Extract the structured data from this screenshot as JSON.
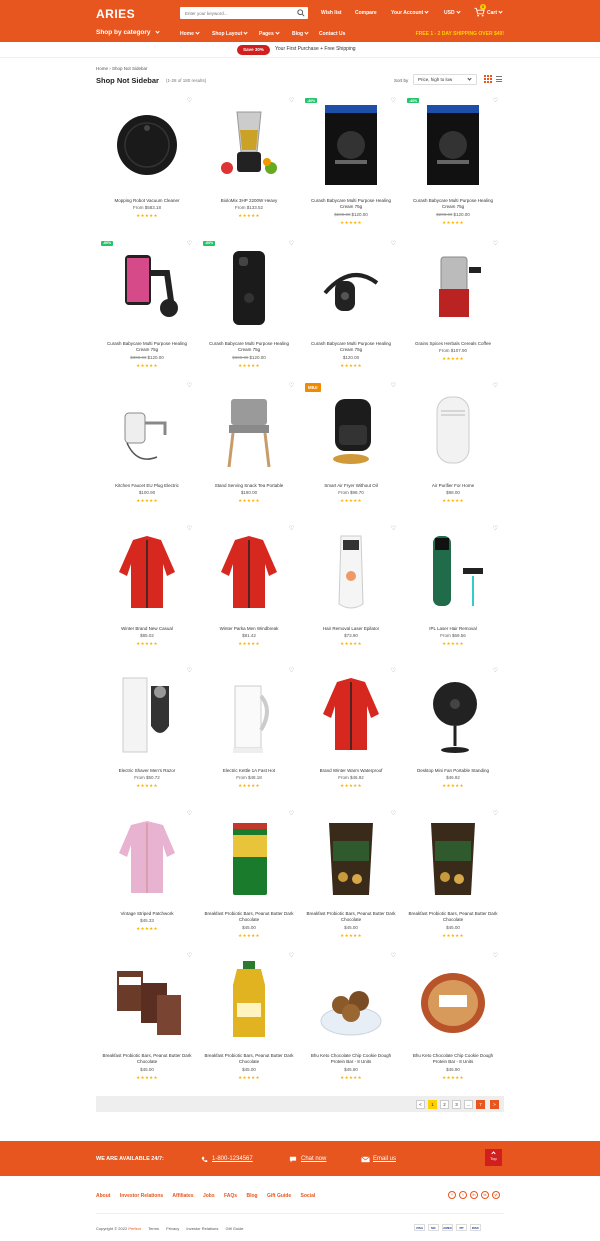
{
  "header": {
    "logo": "ARIES",
    "search_placeholder": "Enter your keyword...",
    "wishlist": "Wish list",
    "compare": "Compare",
    "account": "Your Account",
    "currency": "USD",
    "cart": "Cart",
    "cart_count": "0",
    "category_menu": "Shop by category",
    "nav": [
      "Home",
      "Shop Layout",
      "Pages",
      "Blog",
      "Contact Us"
    ],
    "shipping_note": "FREE 1 - 2 DAY SHIPPING OVER $49!"
  },
  "promo": {
    "pill": "Save 30%",
    "text": "Your First Purchase + Free Shipping"
  },
  "breadcrumb": {
    "home": "Home",
    "current": "Shop Not Sidebar"
  },
  "page": {
    "title": "Shop Not Sidebar",
    "results": "(1-28 of 180 results)"
  },
  "sort": {
    "label": "Sort by",
    "selected": "Price, high to low"
  },
  "products": [
    {
      "name": "Mopping Robot Vacuum Cleaner",
      "price": "From $583.18",
      "old": "",
      "badge": "",
      "icon": "robot-vacuum-icon"
    },
    {
      "name": "BioloMix 3HP 2200W Heavy",
      "price": "From $133.52",
      "old": "",
      "badge": "",
      "icon": "blender-icon"
    },
    {
      "name": "Curash Babycare Multi Purpose Healing Cream 75g",
      "price": "$120.00",
      "old": "$200.00",
      "badge": "-40%",
      "icon": "game-box-icon"
    },
    {
      "name": "Curash Babycare Multi Purpose Healing Cream 75g",
      "price": "$120.00",
      "old": "$200.00",
      "badge": "-40%",
      "icon": "game-box-icon"
    },
    {
      "name": "Curash Babycare Multi Purpose Healing Cream 75g",
      "price": "$120.00",
      "old": "$300.00",
      "badge": "-60%",
      "icon": "phone-holder-icon"
    },
    {
      "name": "Curash Babycare Multi Purpose Healing Cream 75g",
      "price": "$120.00",
      "old": "$300.00",
      "badge": "-60%",
      "icon": "phone-case-icon"
    },
    {
      "name": "Curash Babycare Multi Purpose Healing Cream 75g",
      "price": "$120.00",
      "old": "",
      "badge": "",
      "icon": "headset-icon"
    },
    {
      "name": "Grains Spices Herbals Cereals Coffee",
      "price": "From $107.90",
      "old": "",
      "badge": "",
      "icon": "grinder-icon"
    },
    {
      "name": "Kitchen Faucet EU Plug Electric",
      "price": "$100.90",
      "old": "",
      "badge": "",
      "icon": "faucet-icon"
    },
    {
      "name": "Stand Serving Snack Tea Portable",
      "price": "$180.00",
      "old": "",
      "badge": "",
      "icon": "chair-icon"
    },
    {
      "name": "Smart Air Fryer Without Oil",
      "price": "From $98.70",
      "old": "",
      "badge": "MIUI",
      "icon": "air-fryer-icon"
    },
    {
      "name": "Air Purifier For Home",
      "price": "$98.00",
      "old": "",
      "badge": "",
      "icon": "air-purifier-icon"
    },
    {
      "name": "Winter Brand New Casual",
      "price": "$85.02",
      "old": "",
      "badge": "",
      "icon": "jacket-icon"
    },
    {
      "name": "Winter Parka Men Windbreak",
      "price": "$81.42",
      "old": "",
      "badge": "",
      "icon": "jacket-icon"
    },
    {
      "name": "Hair Removal Laser Epilator",
      "price": "$73.90",
      "old": "",
      "badge": "",
      "icon": "epilator-icon"
    },
    {
      "name": "IPL Laser Hair Removal",
      "price": "From $69.56",
      "old": "",
      "badge": "",
      "icon": "ipl-device-icon"
    },
    {
      "name": "Electric Shaver Men's Razor",
      "price": "From $50.72",
      "old": "",
      "badge": "",
      "icon": "shaver-icon"
    },
    {
      "name": "Electric Kettle 1A Fast Hot",
      "price": "From $48.18",
      "old": "",
      "badge": "",
      "icon": "kettle-icon"
    },
    {
      "name": "Brand Winter Warm Waterproof",
      "price": "From $46.92",
      "old": "",
      "badge": "",
      "icon": "jacket-icon"
    },
    {
      "name": "Desktop Mini Fan Portable Standing",
      "price": "$46.92",
      "old": "",
      "badge": "",
      "icon": "fan-icon"
    },
    {
      "name": "Vintage Striped Patchwork",
      "price": "$45.33",
      "old": "",
      "badge": "",
      "icon": "shirt-icon"
    },
    {
      "name": "Breakfast Probiotic Bars, Peanut Butter Dark Chocolate",
      "price": "$45.00",
      "old": "",
      "badge": "",
      "icon": "food-can-icon"
    },
    {
      "name": "Breakfast Probiotic Bars, Peanut Butter Dark Chocolate",
      "price": "$45.00",
      "old": "",
      "badge": "",
      "icon": "snack-bag-icon"
    },
    {
      "name": "Breakfast Probiotic Bars, Peanut Butter Dark Chocolate",
      "price": "$45.00",
      "old": "",
      "badge": "",
      "icon": "snack-bag-icon"
    },
    {
      "name": "Breakfast Probiotic Bars, Peanut Butter Dark Chocolate",
      "price": "$45.00",
      "old": "",
      "badge": "",
      "icon": "dried-fruit-bags-icon"
    },
    {
      "name": "Breakfast Probiotic Bars, Peanut Butter Dark Chocolate",
      "price": "$45.00",
      "old": "",
      "badge": "",
      "icon": "oil-bottle-icon"
    },
    {
      "name": "Bhu Keto Chocolate Chip Cookie Dough Protein Bar - 8 Units",
      "price": "$45.90",
      "old": "",
      "badge": "",
      "icon": "nuts-bowl-icon"
    },
    {
      "name": "Bhu Keto Chocolate Chip Cookie Dough Protein Bar - 8 Units",
      "price": "$45.90",
      "old": "",
      "badge": "",
      "icon": "nuts-tray-icon"
    }
  ],
  "stars": "★★★★★",
  "pagination": [
    "<",
    "1",
    "2",
    "3",
    "...",
    "7",
    ">"
  ],
  "footer": {
    "available": "WE ARE AVAILABLE 24/7:",
    "phone": "1-800-1234567",
    "chat": "Chat now",
    "email": "Email us",
    "top": "Top",
    "links": [
      "About",
      "Investor Relations",
      "Affiliates",
      "Jobs",
      "FAQs",
      "Blog",
      "Gift Guide",
      "Social"
    ],
    "social": [
      "f",
      "t",
      "in",
      "tk",
      "yt"
    ],
    "copyright": "Copyright © 2022",
    "brand": "Perfect",
    "bottom_links": [
      "Terms",
      "Privacy",
      "Investor Relations",
      "Gift Guide"
    ],
    "payment": [
      "VISA",
      "MC",
      "AMEX",
      "PP",
      "DISC"
    ]
  },
  "colors": {
    "brand": "#e8561f",
    "accent": "#ffd000",
    "sale": "#d11f1f",
    "badge": "#25c46b"
  }
}
